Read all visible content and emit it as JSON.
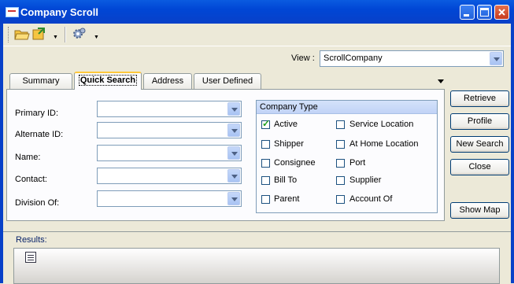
{
  "window": {
    "title": "Company Scroll"
  },
  "toolbar": {
    "buttons": [
      {
        "icon": "open-folder-icon"
      },
      {
        "icon": "export-icon"
      },
      {
        "icon": "settings-gear-icon"
      }
    ]
  },
  "view": {
    "label": "View :",
    "value": "ScrollCompany"
  },
  "tabs": [
    {
      "label": "Summary"
    },
    {
      "label": "Quick Search",
      "active": true
    },
    {
      "label": "Address"
    },
    {
      "label": "User Defined"
    }
  ],
  "form": {
    "fields": [
      {
        "label": "Primary ID:",
        "value": ""
      },
      {
        "label": "Alternate ID:",
        "value": ""
      },
      {
        "label": "Name:",
        "value": ""
      },
      {
        "label": "Contact:",
        "value": ""
      },
      {
        "label": "Division Of:",
        "value": ""
      }
    ]
  },
  "company_type": {
    "title": "Company Type",
    "options": [
      {
        "label": "Active",
        "checked": true
      },
      {
        "label": "Service Location",
        "checked": false
      },
      {
        "label": "Shipper",
        "checked": false
      },
      {
        "label": "At Home Location",
        "checked": false
      },
      {
        "label": "Consignee",
        "checked": false
      },
      {
        "label": "Port",
        "checked": false
      },
      {
        "label": "Bill To",
        "checked": false
      },
      {
        "label": "Supplier",
        "checked": false
      },
      {
        "label": "Parent",
        "checked": false
      },
      {
        "label": "Account Of",
        "checked": false
      }
    ]
  },
  "actions": {
    "retrieve": "Retrieve",
    "profile": "Profile",
    "new_search": "New Search",
    "close": "Close",
    "show_map": "Show Map"
  },
  "results": {
    "label": "Results:"
  },
  "colors": {
    "titlebar": "#0046D5",
    "window_bg": "#ECE9D8",
    "checkmark": "#21A121"
  }
}
